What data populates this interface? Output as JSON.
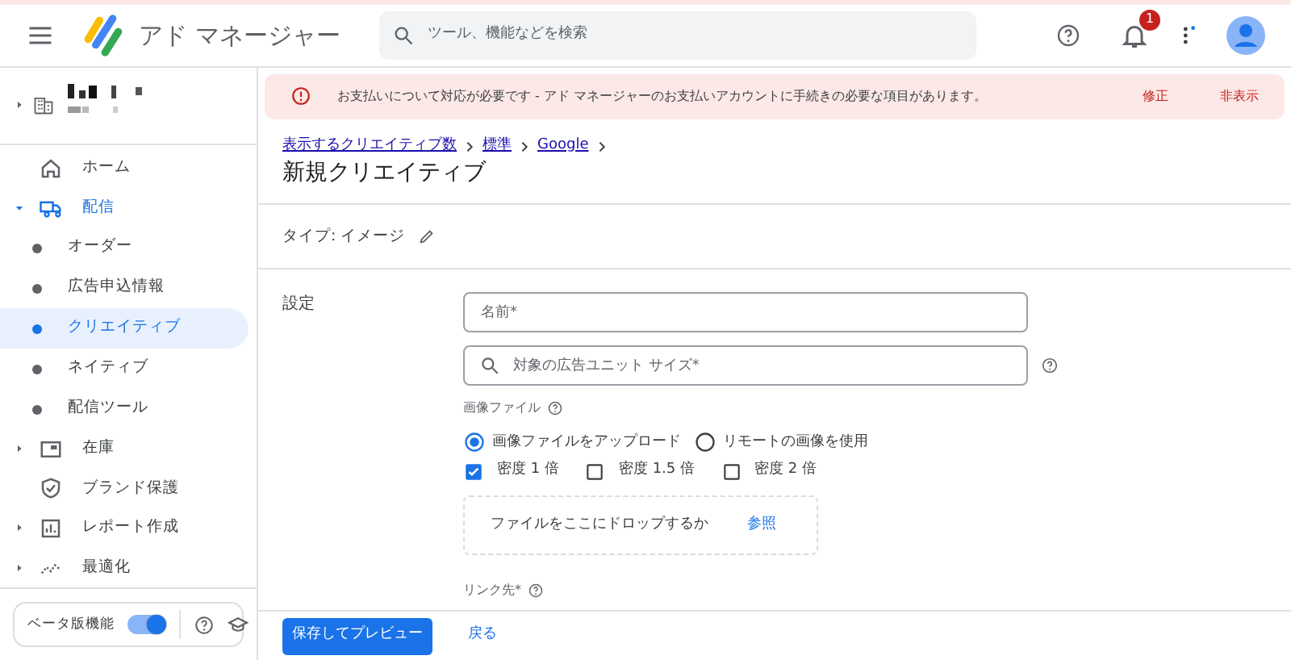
{
  "header": {
    "app_title": "アド マネージャー",
    "search_placeholder": "ツール、機能などを検索",
    "notification_count": "1"
  },
  "sidebar": {
    "account_expanded": false,
    "items": [
      {
        "label": "ホーム",
        "selected": false
      },
      {
        "label": "配信",
        "selected": true,
        "expanded": true,
        "children": [
          {
            "label": "オーダー",
            "selected": false
          },
          {
            "label": "広告申込情報",
            "selected": false
          },
          {
            "label": "クリエイティブ",
            "selected": true
          },
          {
            "label": "ネイティブ",
            "selected": false
          },
          {
            "label": "配信ツール",
            "selected": false
          }
        ]
      },
      {
        "label": "在庫",
        "selected": false,
        "expanded": false
      },
      {
        "label": "ブランド保護",
        "selected": false
      },
      {
        "label": "レポート作成",
        "selected": false,
        "expanded": false
      },
      {
        "label": "最適化",
        "selected": false,
        "expanded": false
      }
    ],
    "beta": {
      "label": "ベータ版機能",
      "on": true
    }
  },
  "banner": {
    "message": "お支払いについて対応が必要です - アド マネージャーのお支払いアカウントに手続きの必要な項目があります。",
    "actions": [
      "修正",
      "非表示"
    ]
  },
  "breadcrumb": [
    "表示するクリエイティブ数",
    "標準",
    "Google"
  ],
  "page_title": "新規クリエイティブ",
  "type_label": "タイプ: イメージ",
  "section_label": "設定",
  "name_field": {
    "placeholder": "名前*"
  },
  "size_field": {
    "placeholder": "対象の広告ユニット サイズ*"
  },
  "image_file": {
    "label": "画像ファイル",
    "radios": [
      {
        "label": "画像ファイルをアップロード",
        "selected": true
      },
      {
        "label": "リモートの画像を使用",
        "selected": false
      }
    ],
    "checkboxes": [
      {
        "label": "密度 1 倍",
        "checked": true
      },
      {
        "label": "密度 1.5 倍",
        "checked": false
      },
      {
        "label": "密度 2 倍",
        "checked": false
      }
    ],
    "dropzone": {
      "text": "ファイルをここにドロップするか",
      "link": "参照"
    }
  },
  "link_label": "リンク先*",
  "footer": {
    "primary": "保存してプレビュー",
    "secondary": "戻る"
  }
}
